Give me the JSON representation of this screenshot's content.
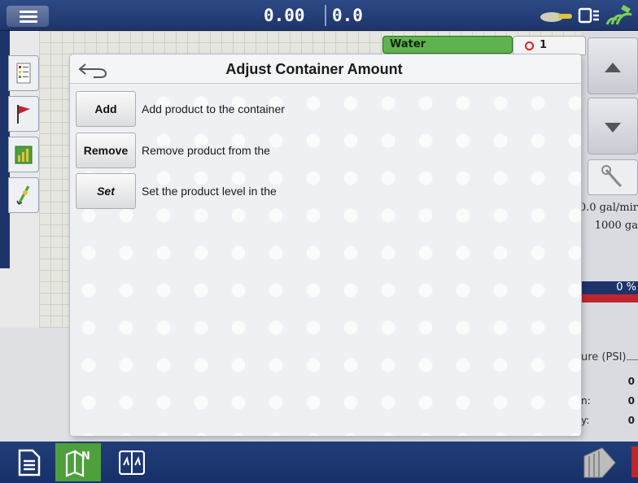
{
  "topbar": {
    "readout_left": "0.00",
    "readout_right": "0.0",
    "icons": [
      "menu-icon",
      "tractor-icon",
      "implement-box-icon",
      "satellite-gps-icon"
    ]
  },
  "left_tabs": [
    "list-icon",
    "flag-icon",
    "bar-chart-icon",
    "planter-icon"
  ],
  "map": {
    "product_tag": "Water",
    "alarm_count": "1"
  },
  "right_panel": {
    "rate": "0.0 gal/mir",
    "container": "1000 ga",
    "bar_percent_label": "0 %",
    "pressure_label": "ure (PSI)",
    "rows": [
      {
        "key": "",
        "value": "0"
      },
      {
        "key": "n:",
        "value": "0"
      },
      {
        "key": "y:",
        "value": "0"
      }
    ]
  },
  "modal": {
    "title": "Adjust Container Amount",
    "options": [
      {
        "label": "Add",
        "description": "Add product to the container"
      },
      {
        "label": "Remove",
        "description": "Remove product from the"
      },
      {
        "label": "Set",
        "description": "Set the product level in the"
      }
    ]
  },
  "colors": {
    "topbar": "#1d346a",
    "accent_green": "#4ea03c",
    "alarm_red": "#c0262d"
  }
}
